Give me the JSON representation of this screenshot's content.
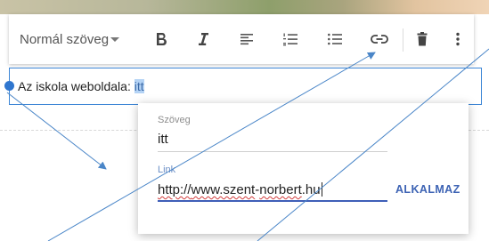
{
  "toolbar": {
    "style_select": "Normál szöveg",
    "buttons": [
      "bold",
      "italic",
      "align-left",
      "numbered-list",
      "bulleted-list",
      "link",
      "delete",
      "more"
    ]
  },
  "editor": {
    "text": "Az iskola weboldala: ",
    "selected_text": "itt"
  },
  "link_dialog": {
    "text_label": "Szöveg",
    "text_value": "itt",
    "link_label": "Link",
    "link_prefix": "http://",
    "link_host_a": "www.szent",
    "link_dash": "-",
    "link_host_b": "norbert",
    "link_tld": ".hu",
    "apply_label": "ALKALMAZ"
  },
  "colors": {
    "accent": "#3f5fb8",
    "selection": "#b4d3f5",
    "annotation_arrow": "#4a86c8"
  }
}
